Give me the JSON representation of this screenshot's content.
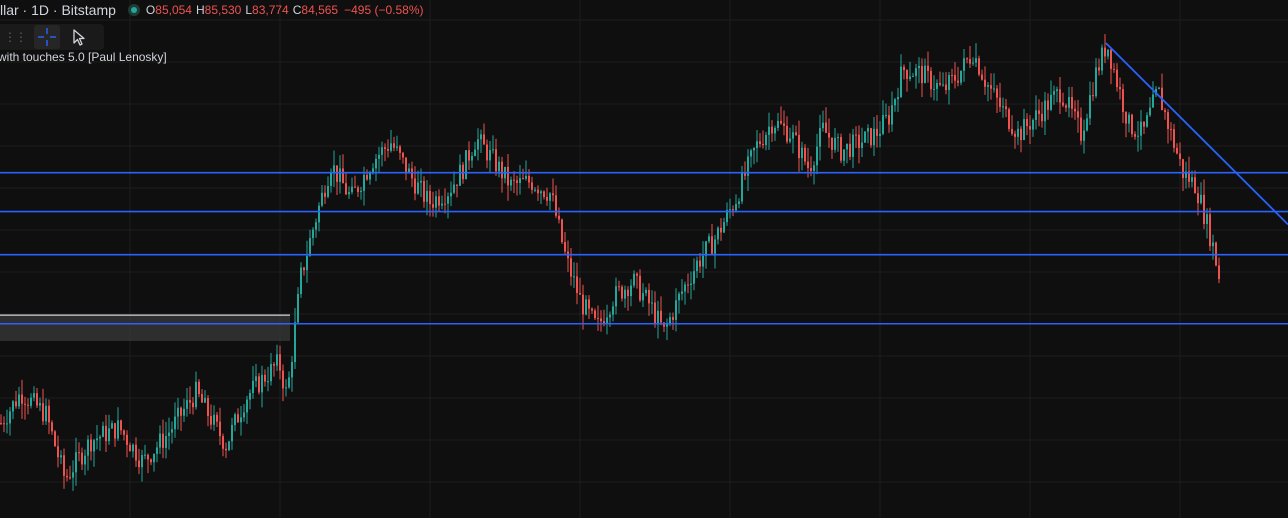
{
  "legend": {
    "symbol": "llar · 1D · Bitstamp",
    "open_key": "O",
    "open": "85,054",
    "high_key": "H",
    "high": "85,530",
    "low_key": "L",
    "low": "83,774",
    "close_key": "C",
    "close": "84,565",
    "change": "−495 (−0.58%)"
  },
  "toolbar": {
    "grip_icon": "grip-dots-icon",
    "crosshair_icon": "crosshair-icon",
    "cursor_icon": "arrow-cursor-icon"
  },
  "indicator": {
    "label": "with touches 5.0 [Paul Lenosky]"
  },
  "colors": {
    "background": "#0f0f0f",
    "grid": "#1e1e1e",
    "up_candle": "#26a69a",
    "down_candle": "#ef5350",
    "level_line": "#2962ff",
    "trend_line": "#2962ff",
    "zone_fill": "#3a3a3a",
    "zone_border": "#d1d4dc"
  },
  "chart_data": {
    "type": "candlestick",
    "timeframe": "1D",
    "exchange": "Bitstamp",
    "ylim": [
      52000,
      112000
    ],
    "price_path": [
      [
        0,
        63000
      ],
      [
        20,
        66500
      ],
      [
        45,
        64000
      ],
      [
        64,
        56500
      ],
      [
        90,
        61000
      ],
      [
        118,
        62500
      ],
      [
        142,
        58500
      ],
      [
        165,
        61500
      ],
      [
        195,
        66500
      ],
      [
        225,
        60500
      ],
      [
        245,
        66000
      ],
      [
        265,
        68500
      ],
      [
        278,
        70000
      ],
      [
        286,
        66000
      ],
      [
        300,
        80000
      ],
      [
        312,
        85500
      ],
      [
        330,
        93000
      ],
      [
        350,
        89000
      ],
      [
        372,
        93500
      ],
      [
        390,
        95500
      ],
      [
        410,
        91500
      ],
      [
        428,
        88500
      ],
      [
        448,
        90000
      ],
      [
        462,
        92500
      ],
      [
        475,
        96000
      ],
      [
        492,
        93500
      ],
      [
        510,
        90500
      ],
      [
        530,
        91000
      ],
      [
        550,
        89500
      ],
      [
        565,
        82000
      ],
      [
        580,
        77000
      ],
      [
        596,
        74000
      ],
      [
        612,
        77500
      ],
      [
        632,
        79500
      ],
      [
        650,
        76500
      ],
      [
        663,
        73500
      ],
      [
        680,
        78000
      ],
      [
        696,
        81500
      ],
      [
        715,
        84500
      ],
      [
        735,
        89000
      ],
      [
        755,
        95000
      ],
      [
        772,
        98000
      ],
      [
        790,
        96500
      ],
      [
        808,
        92500
      ],
      [
        822,
        97000
      ],
      [
        840,
        94500
      ],
      [
        858,
        95500
      ],
      [
        875,
        96500
      ],
      [
        888,
        98500
      ],
      [
        902,
        104000
      ],
      [
        920,
        103500
      ],
      [
        942,
        101500
      ],
      [
        958,
        103500
      ],
      [
        972,
        106000
      ],
      [
        985,
        102500
      ],
      [
        1000,
        99500
      ],
      [
        1018,
        96500
      ],
      [
        1035,
        98500
      ],
      [
        1060,
        101500
      ],
      [
        1080,
        96500
      ],
      [
        1095,
        103500
      ],
      [
        1106,
        107000
      ],
      [
        1115,
        103000
      ],
      [
        1128,
        97500
      ],
      [
        1142,
        96500
      ],
      [
        1157,
        101500
      ],
      [
        1170,
        96500
      ],
      [
        1182,
        92000
      ],
      [
        1195,
        90500
      ],
      [
        1205,
        86500
      ],
      [
        1212,
        83500
      ],
      [
        1218,
        80000
      ]
    ],
    "levels": [
      92000,
      87500,
      82500,
      74500
    ],
    "zone": {
      "from_x": 0,
      "to_x": 290,
      "top": 75500,
      "bottom": 72500
    },
    "trend_line": {
      "from": [
        1106,
        107000
      ],
      "to": [
        1288,
        86000
      ]
    },
    "last": {
      "open": 85054,
      "high": 85530,
      "low": 83774,
      "close": 84565,
      "change": -495,
      "change_pct": -0.58
    }
  }
}
